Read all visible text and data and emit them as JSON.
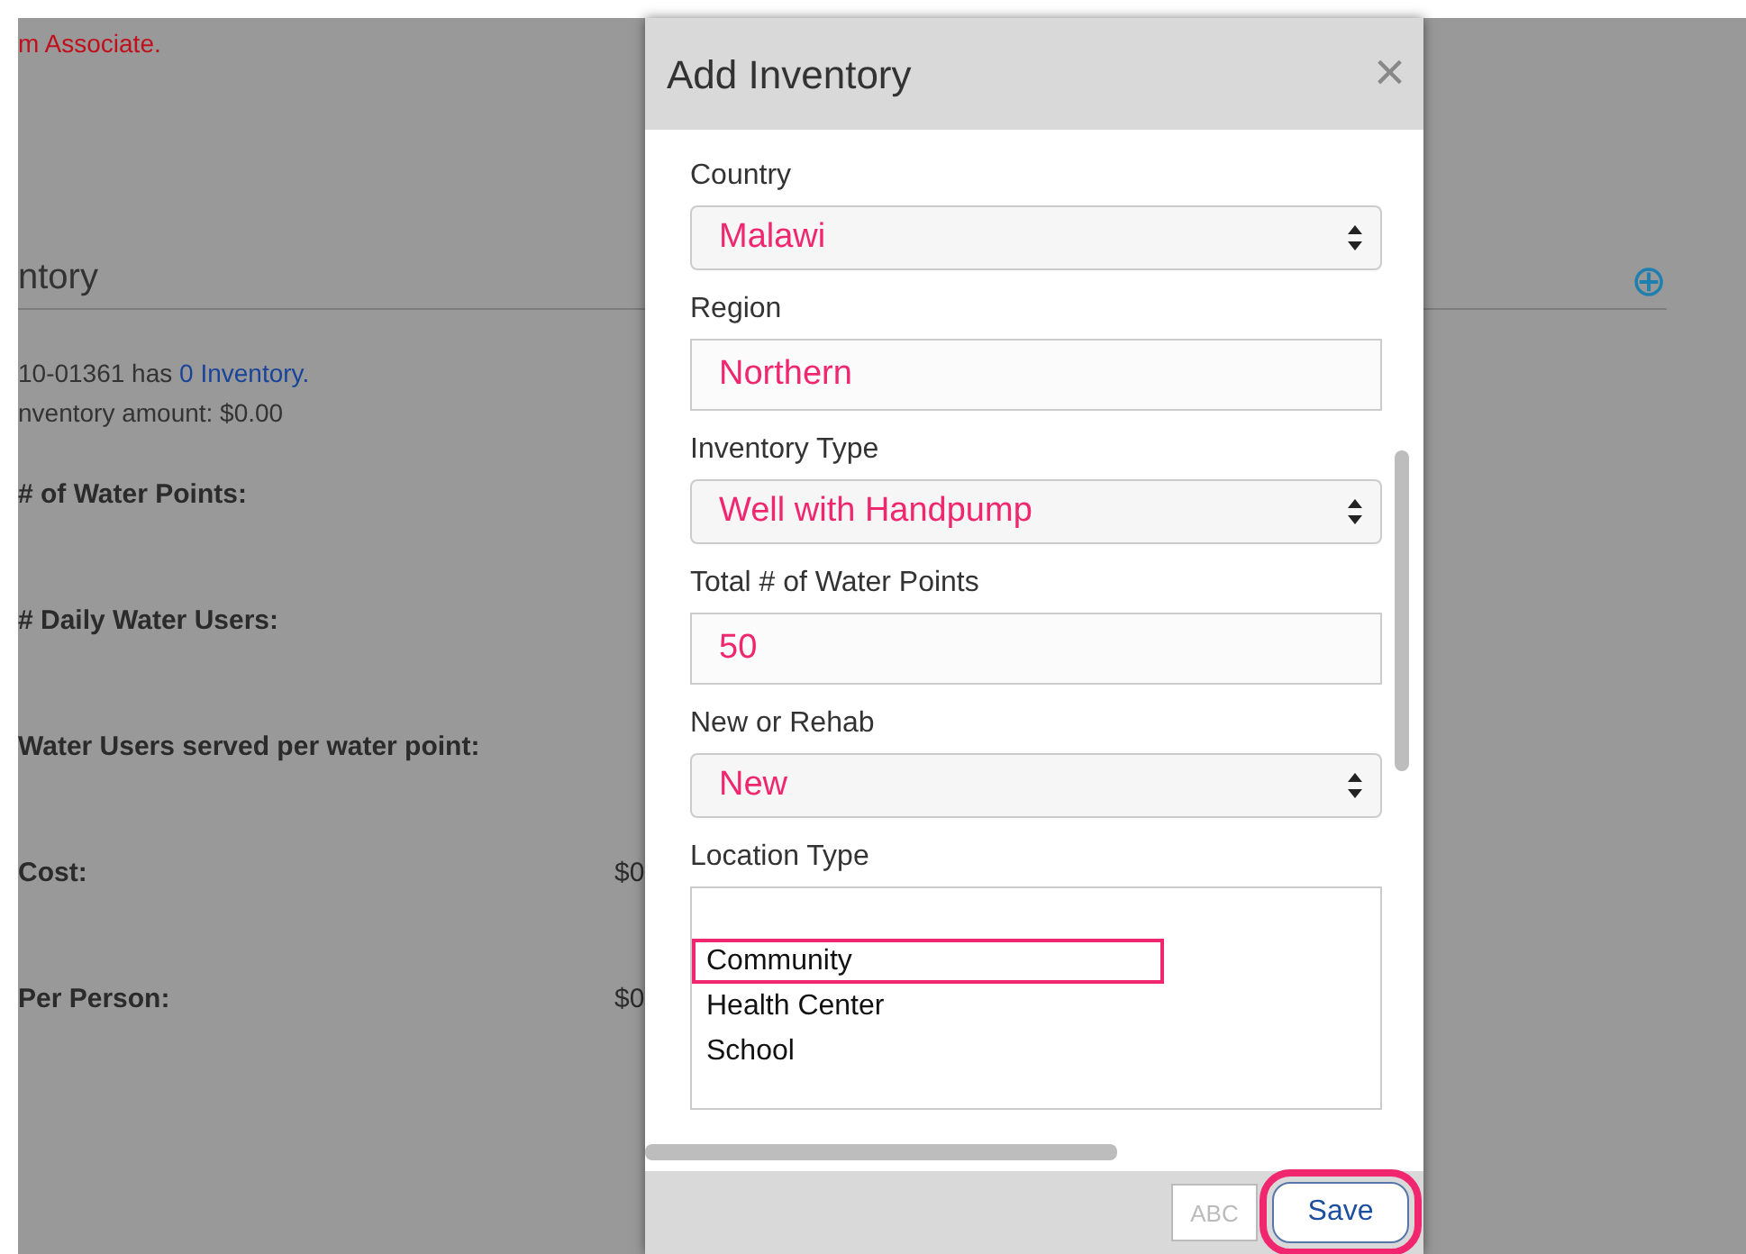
{
  "page": {
    "notice": "m Associate.",
    "section_title": "ntory",
    "summary_prefix": "10-01361 has ",
    "summary_link": "0 Inventory.",
    "amount": "nventory amount: $0.00",
    "add_button": "⊕",
    "fields": [
      {
        "label": "# of Water Points:"
      },
      {
        "label": "# Daily Water Users:"
      },
      {
        "label": "Water Users served per water point:"
      },
      {
        "label": "Cost:",
        "value": "$0"
      },
      {
        "label": "Per Person:",
        "value": "$0"
      }
    ]
  },
  "dialog": {
    "title": "Add Inventory",
    "close": "×",
    "fields": [
      {
        "kind": "select",
        "label": "Country",
        "value": "Malawi"
      },
      {
        "kind": "text",
        "label": "Region",
        "value": "Northern"
      },
      {
        "kind": "select",
        "label": "Inventory Type",
        "value": "Well with Handpump"
      },
      {
        "kind": "text",
        "label": "Total # of Water Points",
        "value": "50"
      },
      {
        "kind": "select",
        "label": "New or Rehab",
        "value": "New"
      },
      {
        "kind": "list",
        "label": "Location Type",
        "options": [
          {
            "label": "Community",
            "selected": true
          },
          {
            "label": "Health Center",
            "selected": false
          },
          {
            "label": "School",
            "selected": false
          }
        ]
      }
    ],
    "spellcheck": "ABC",
    "save": {
      "label": "Save",
      "highlighted": true
    }
  }
}
